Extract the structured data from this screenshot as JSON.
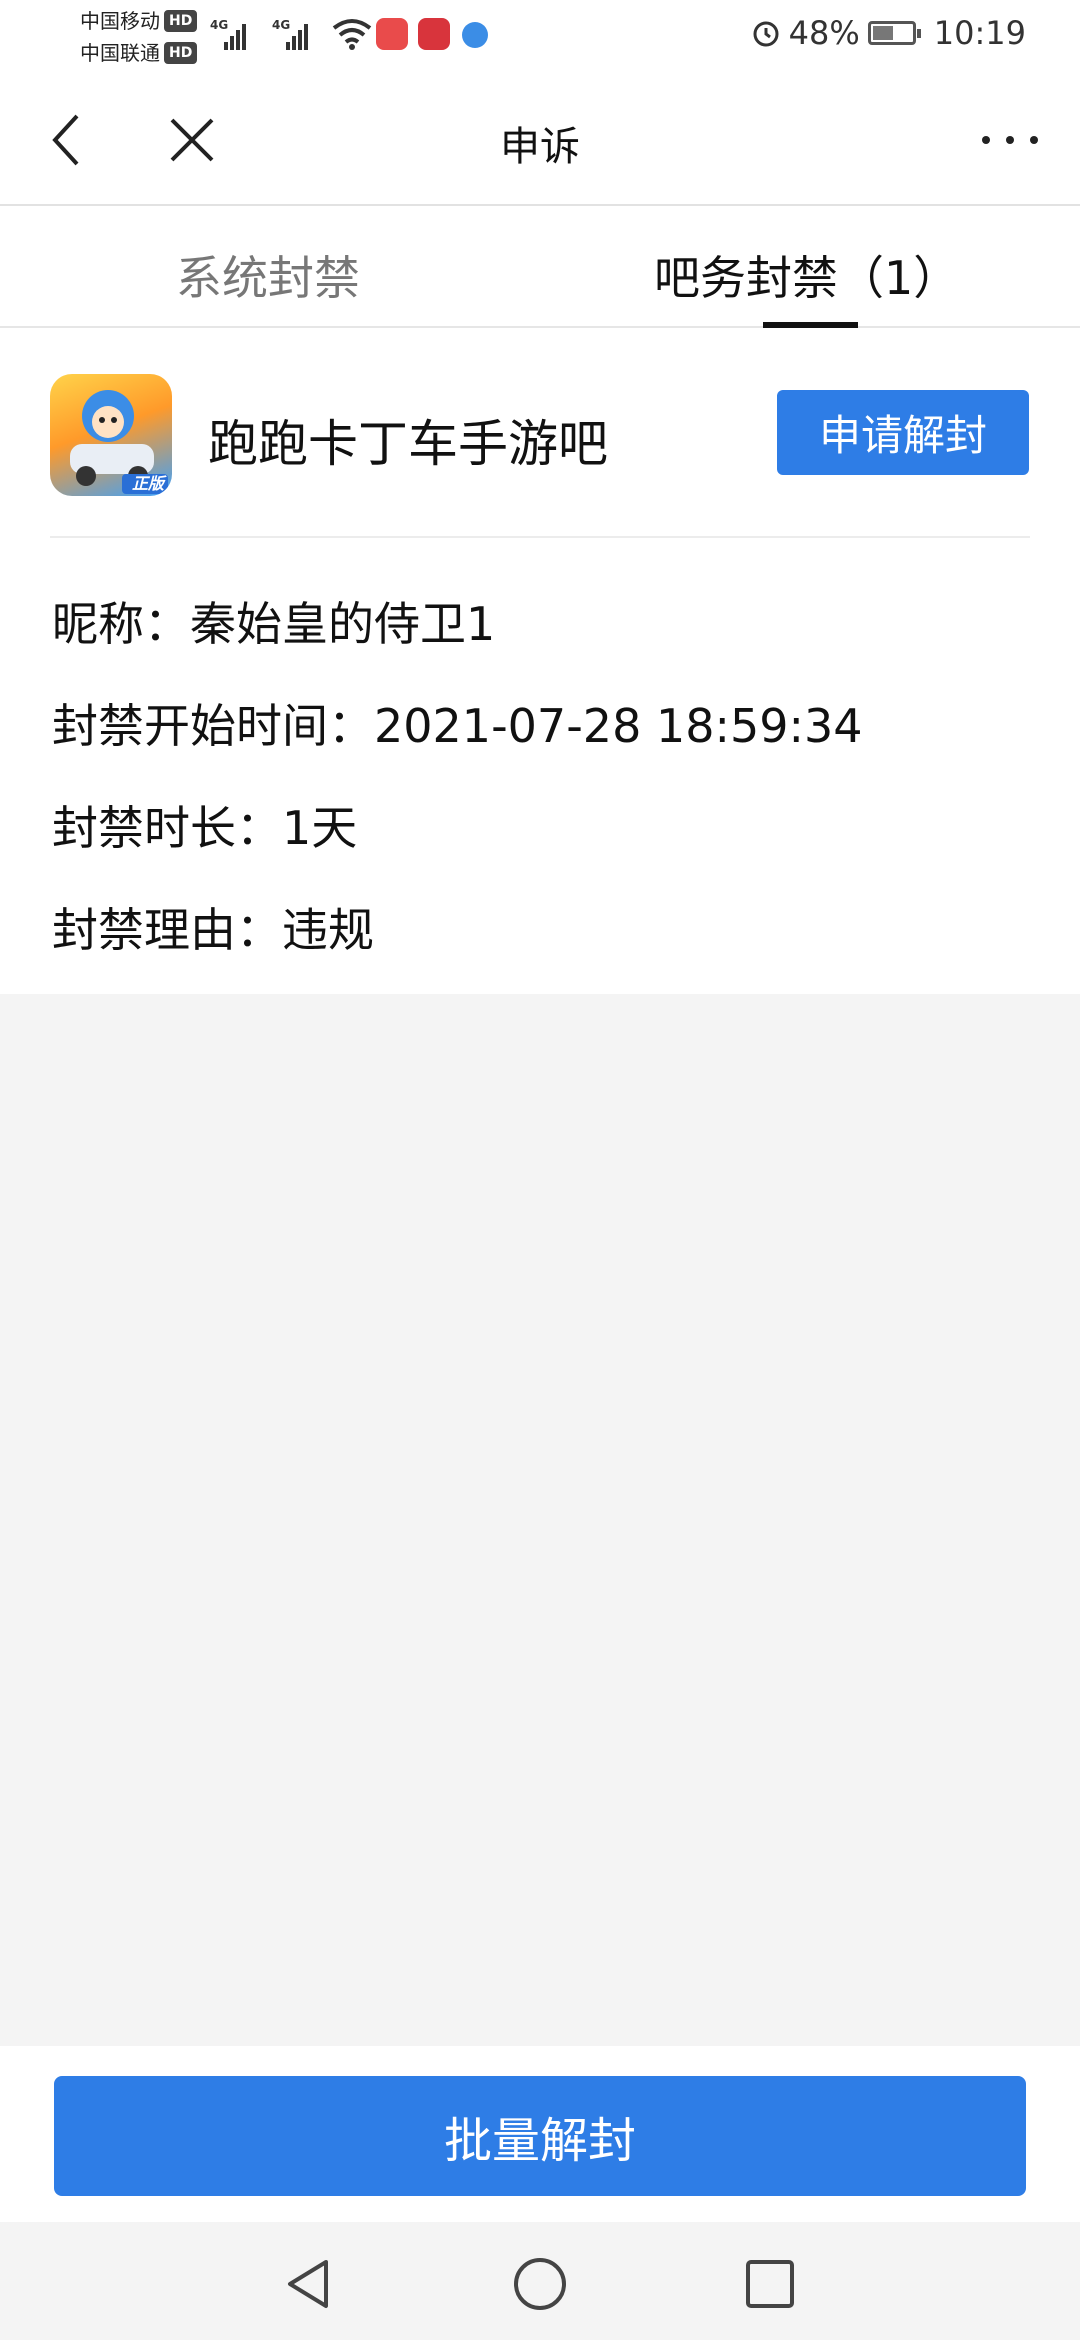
{
  "status": {
    "carrier1": "中国移动",
    "carrier2": "中国联通",
    "hd": "HD",
    "net1": "4G",
    "net2": "4G",
    "battery": "48%",
    "time": "10:19"
  },
  "header": {
    "title": "申诉"
  },
  "tabs": [
    {
      "label": "系统封禁",
      "active": false
    },
    {
      "label": "吧务封禁（1）",
      "active": true
    }
  ],
  "ban": {
    "bar_name": "跑跑卡丁车手游吧",
    "unban_label": "申请解封",
    "logo_badge": "正版",
    "nickname": "昵称：秦始皇的侍卫1",
    "start_time": "封禁开始时间：2021-07-28 18:59:34",
    "duration": "封禁时长：1天",
    "reason": "封禁理由：违规"
  },
  "footer": {
    "batch_unban_label": "批量解封"
  },
  "colors": {
    "primary": "#2e7de6",
    "background": "#f4f4f4"
  },
  "icons": [
    "back-arrow-icon",
    "close-icon",
    "more-icon",
    "wifi-icon",
    "alarm-icon",
    "battery-icon",
    "nav-back-icon",
    "nav-home-icon",
    "nav-recent-icon"
  ]
}
